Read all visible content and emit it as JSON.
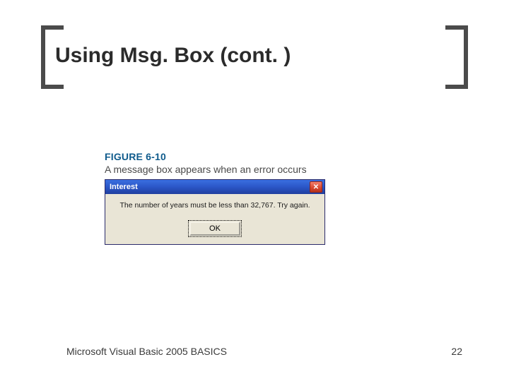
{
  "slide": {
    "title": "Using Msg. Box (cont. )",
    "footer_text": "Microsoft Visual Basic 2005 BASICS",
    "page_number": "22"
  },
  "figure": {
    "number": "FIGURE 6-10",
    "caption": "A message box appears when an error occurs"
  },
  "dialog": {
    "title": "Interest",
    "message": "The number of years must be less than 32,767. Try again.",
    "ok_label": "OK",
    "close_glyph": "✕"
  }
}
